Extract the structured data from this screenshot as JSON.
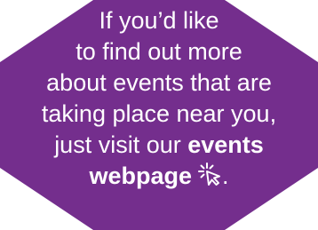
{
  "callout": {
    "lines": [
      "If you’d like",
      "to find out more",
      "about events that are",
      "taking place near you,"
    ],
    "last_line_prefix": "just visit our ",
    "link_text_1": "events",
    "link_text_2": "webpage",
    "final_period": "."
  },
  "colors": {
    "background": "#742E8D",
    "text": "#FFFFFF"
  },
  "icons": {
    "link_icon": "click-cursor-icon"
  }
}
